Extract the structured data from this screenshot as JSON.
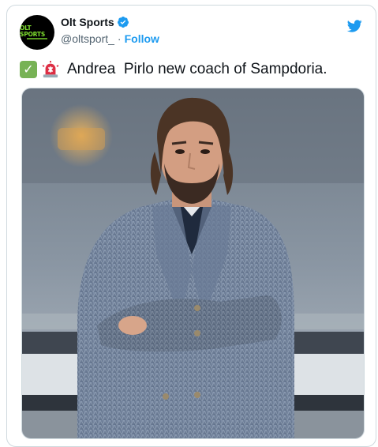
{
  "account": {
    "display_name": "Olt Sports",
    "handle": "@oltsport_",
    "separator": "·",
    "follow_label": "Follow",
    "avatar_text": "OLT SPORTS"
  },
  "tweet": {
    "text": "Andrea  Pirlo new coach of Sampdoria.",
    "emojis": [
      "check-mark-emoji",
      "siren-emoji"
    ]
  },
  "media": {
    "description_icon": "photo"
  },
  "colors": {
    "accent": "#1d9bf0",
    "text": "#0f1419",
    "muted": "#536471",
    "check_green": "#77b255"
  }
}
